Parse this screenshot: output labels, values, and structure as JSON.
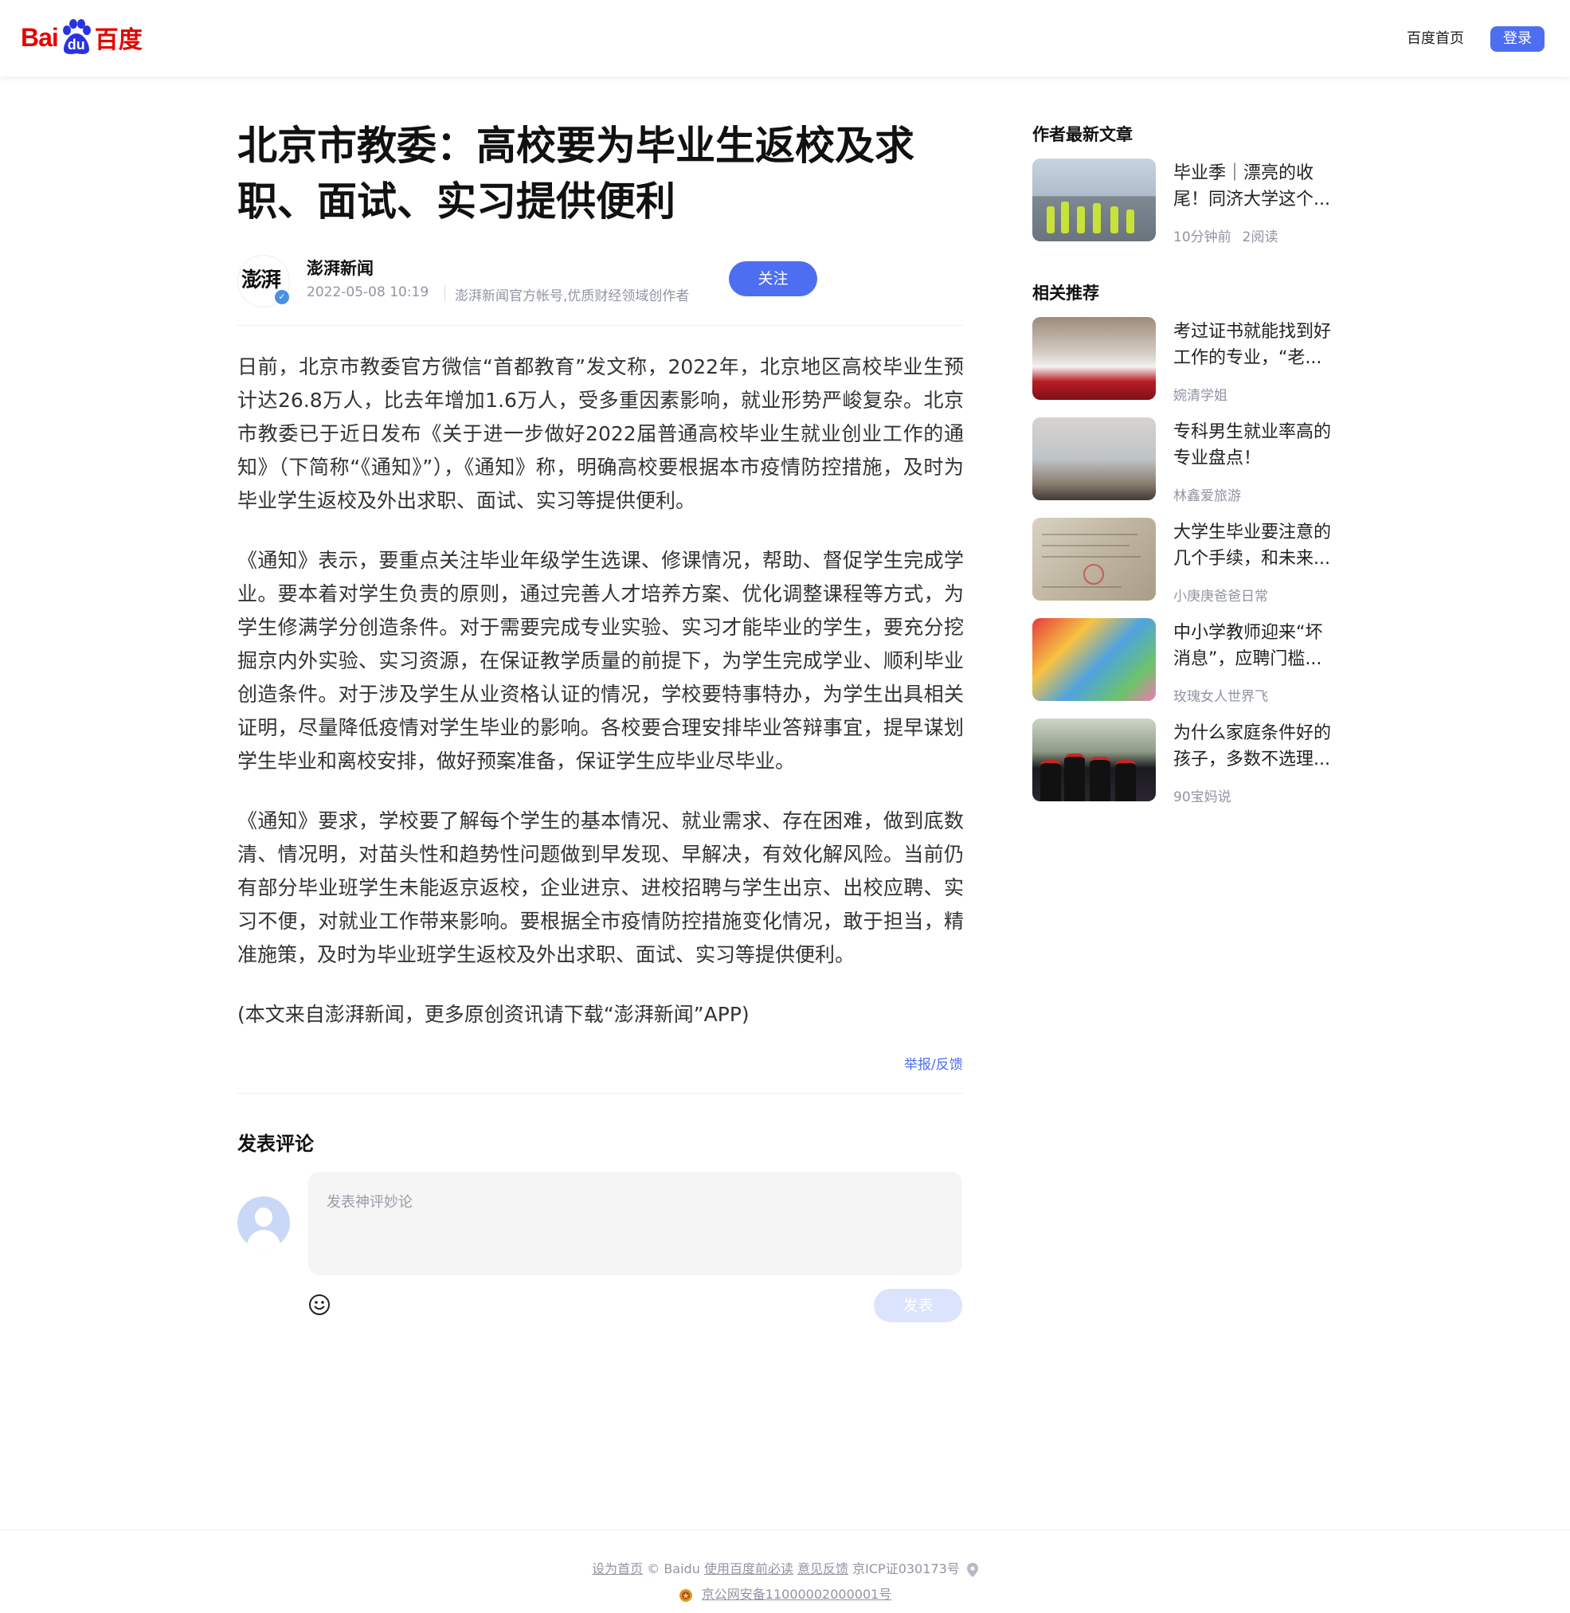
{
  "header": {
    "logo_latin_1": "Bai",
    "logo_latin_2": "du",
    "logo_cn": "百度",
    "nav_home": "百度首页",
    "login": "登录",
    "brand_red": "#e10601",
    "accent_blue": "#4e6ef2"
  },
  "article": {
    "title": "北京市教委：高校要为毕业生返校及求职、面试、实习提供便利",
    "author": {
      "avatar_text": "澎湃",
      "name": "澎湃新闻",
      "date": "2022-05-08 10:19",
      "description": "澎湃新闻官方帐号,优质财经领域创作者",
      "follow": "关注",
      "verified_icon": "verified-badge-icon"
    },
    "paragraphs": [
      "日前，北京市教委官方微信“首都教育”发文称，2022年，北京地区高校毕业生预计达26.8万人，比去年增加1.6万人，受多重因素影响，就业形势严峻复杂。北京市教委已于近日发布《关于进一步做好2022届普通高校毕业生就业创业工作的通知》（下简称“《通知》”），《通知》称，明确高校要根据本市疫情防控措施，及时为毕业学生返校及外出求职、面试、实习等提供便利。",
      "《通知》表示，要重点关注毕业年级学生选课、修课情况，帮助、督促学生完成学业。要本着对学生负责的原则，通过完善人才培养方案、优化调整课程等方式，为学生修满学分创造条件。对于需要完成专业实验、实习才能毕业的学生，要充分挖掘京内外实验、实习资源，在保证教学质量的前提下，为学生完成学业、顺利毕业创造条件。对于涉及学生从业资格认证的情况，学校要特事特办，为学生出具相关证明，尽量降低疫情对学生毕业的影响。各校要合理安排毕业答辩事宜，提早谋划学生毕业和离校安排，做好预案准备，保证学生应毕业尽毕业。",
      "《通知》要求，学校要了解每个学生的基本情况、就业需求、存在困难，做到底数清、情况明，对苗头性和趋势性问题做到早发现、早解决，有效化解风险。当前仍有部分毕业班学生未能返京返校，企业进京、进校招聘与学生出京、出校应聘、实习不便，对就业工作带来影响。要根据全市疫情防控措施变化情况，敢于担当，精准施策，及时为毕业班学生返校及外出求职、面试、实习等提供便利。",
      "(本文来自澎湃新闻，更多原创资讯请下载“澎湃新闻”APP)"
    ],
    "report": "举报/反馈"
  },
  "comment": {
    "title": "发表评论",
    "placeholder": "发表神评妙论",
    "submit": "发表",
    "emoji_icon": "smiley-icon"
  },
  "sidebar": {
    "author_latest_title": "作者最新文章",
    "author_latest": [
      {
        "title": "毕业季｜漂亮的收尾！同济大学这个...",
        "time": "10分钟前",
        "reads": "2阅读"
      }
    ],
    "related_title": "相关推荐",
    "related": [
      {
        "title": "考过证书就能找到好工作的专业，“老...",
        "source": "婉清学姐"
      },
      {
        "title": "专科男生就业率高的专业盘点！",
        "source": "林鑫爱旅游"
      },
      {
        "title": "大学生毕业要注意的几个手续，和未来...",
        "source": "小庚庚爸爸日常"
      },
      {
        "title": "中小学教师迎来“坏消息”，应聘门槛...",
        "source": "玫瑰女人世界飞"
      },
      {
        "title": "为什么家庭条件好的孩子，多数不选理...",
        "source": "90宝妈说"
      }
    ]
  },
  "footer": {
    "set_home": "设为首页",
    "copyright": "© Baidu",
    "must_read": "使用百度前必读",
    "feedback": "意见反馈",
    "icp": "京ICP证030173号",
    "police": "京公网安备11000002000001号"
  }
}
